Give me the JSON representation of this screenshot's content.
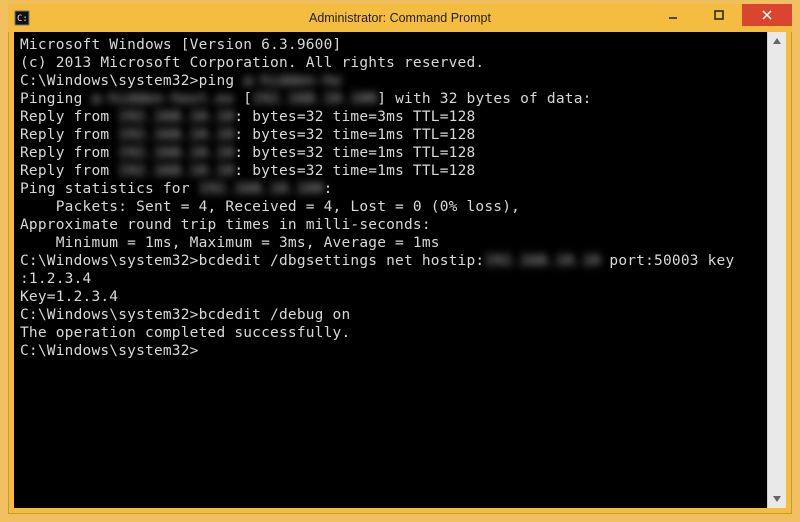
{
  "window": {
    "title": "Administrator: Command Prompt"
  },
  "console": {
    "lines": [
      {
        "segments": [
          {
            "t": "Microsoft Windows [Version 6.3.9600]"
          }
        ]
      },
      {
        "segments": [
          {
            "t": "(c) 2013 Microsoft Corporation. All rights reserved."
          }
        ]
      },
      {
        "segments": [
          {
            "t": ""
          }
        ]
      },
      {
        "segments": [
          {
            "t": "C:\\Windows\\system32>ping "
          },
          {
            "t": "a-hidden-ho",
            "blur": true
          }
        ]
      },
      {
        "segments": [
          {
            "t": ""
          }
        ]
      },
      {
        "segments": [
          {
            "t": "Pinging "
          },
          {
            "t": "a-hidden-host.ex",
            "blur": true
          },
          {
            "t": " ["
          },
          {
            "t": "192.168.10.100",
            "blur": true
          },
          {
            "t": "] with 32 bytes of data:"
          }
        ]
      },
      {
        "segments": [
          {
            "t": "Reply from "
          },
          {
            "t": "192.168.10.10",
            "blur": true
          },
          {
            "t": ": bytes=32 time=3ms TTL=128"
          }
        ]
      },
      {
        "segments": [
          {
            "t": "Reply from "
          },
          {
            "t": "192.168.10.10",
            "blur": true
          },
          {
            "t": ": bytes=32 time=1ms TTL=128"
          }
        ]
      },
      {
        "segments": [
          {
            "t": "Reply from "
          },
          {
            "t": "192.168.10.10",
            "blur": true
          },
          {
            "t": ": bytes=32 time=1ms TTL=128"
          }
        ]
      },
      {
        "segments": [
          {
            "t": "Reply from "
          },
          {
            "t": "192.168.10.10",
            "blur": true
          },
          {
            "t": ": bytes=32 time=1ms TTL=128"
          }
        ]
      },
      {
        "segments": [
          {
            "t": ""
          }
        ]
      },
      {
        "segments": [
          {
            "t": "Ping statistics for "
          },
          {
            "t": "192.168.10.100",
            "blur": true
          },
          {
            "t": ":"
          }
        ]
      },
      {
        "segments": [
          {
            "t": "    Packets: Sent = 4, Received = 4, Lost = 0 (0% loss),"
          }
        ]
      },
      {
        "segments": [
          {
            "t": "Approximate round trip times in milli-seconds:"
          }
        ]
      },
      {
        "segments": [
          {
            "t": "    Minimum = 1ms, Maximum = 3ms, Average = 1ms"
          }
        ]
      },
      {
        "segments": [
          {
            "t": ""
          }
        ]
      },
      {
        "segments": [
          {
            "t": "C:\\Windows\\system32>bcdedit /dbgsettings net hostip:"
          },
          {
            "t": "192.168.10.10",
            "blur": true
          },
          {
            "t": " port:50003 key"
          }
        ]
      },
      {
        "segments": [
          {
            "t": ":1.2.3.4"
          }
        ]
      },
      {
        "segments": [
          {
            "t": "Key=1.2.3.4"
          }
        ]
      },
      {
        "segments": [
          {
            "t": ""
          }
        ]
      },
      {
        "segments": [
          {
            "t": "C:\\Windows\\system32>bcdedit /debug on"
          }
        ]
      },
      {
        "segments": [
          {
            "t": "The operation completed successfully."
          }
        ]
      },
      {
        "segments": [
          {
            "t": ""
          }
        ]
      },
      {
        "segments": [
          {
            "t": "C:\\Windows\\system32>"
          }
        ]
      }
    ]
  }
}
